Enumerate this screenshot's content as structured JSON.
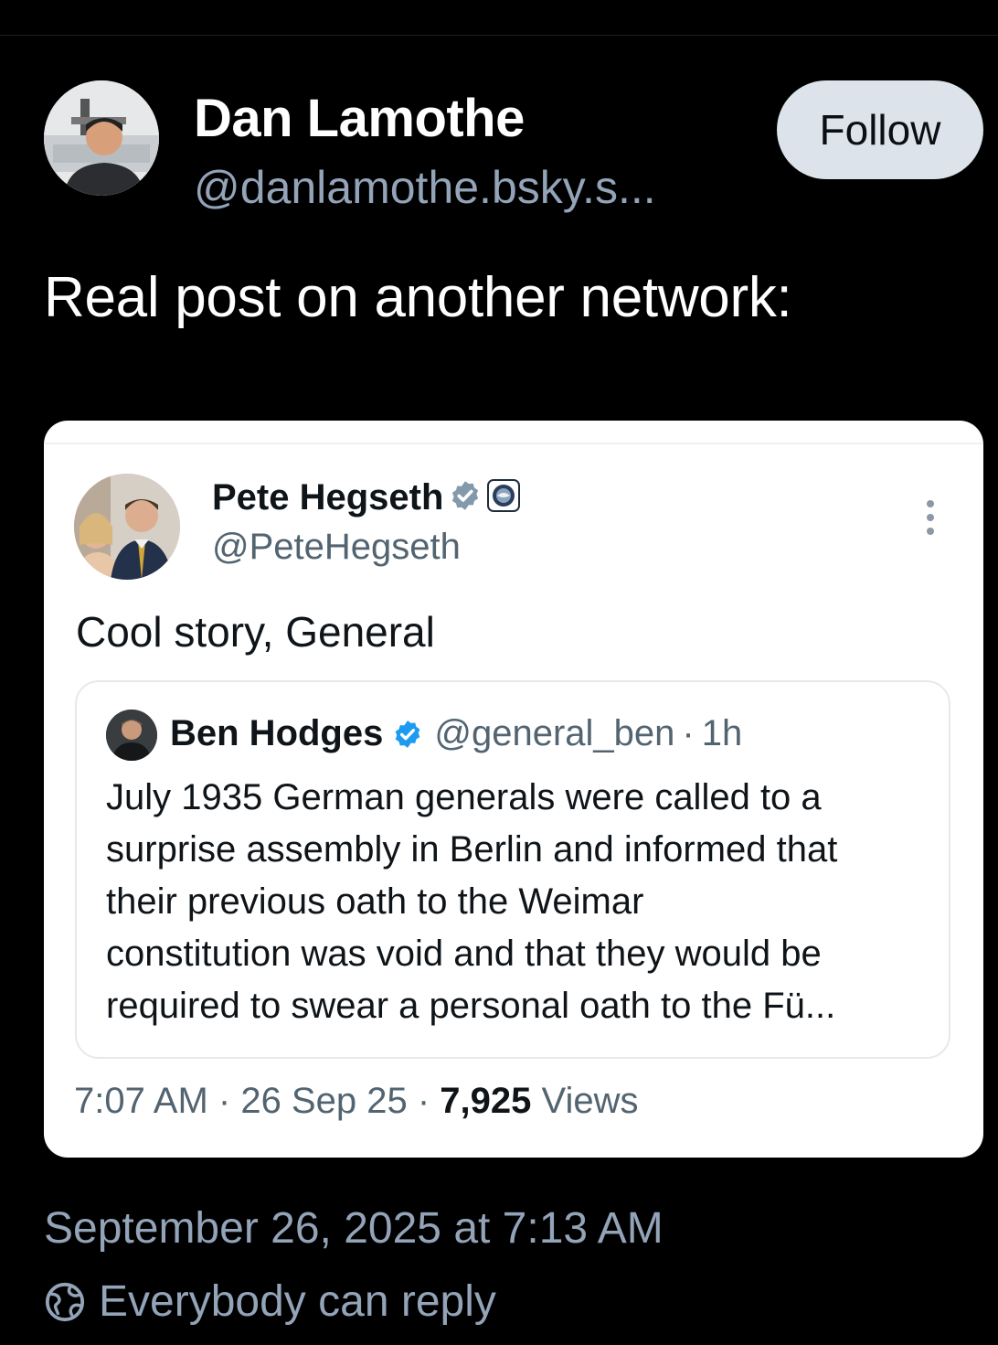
{
  "post": {
    "author_name": "Dan Lamothe",
    "author_handle": "@danlamothe.bsky.s...",
    "follow_label": "Follow",
    "text": "Real post on another network:",
    "timestamp": "September 26, 2025 at 7:13 AM",
    "reply_setting": "Everybody can reply"
  },
  "embed": {
    "name": "Pete Hegseth",
    "handle": "@PeteHegseth",
    "text": "Cool story, General",
    "quote": {
      "name": "Ben Hodges",
      "handle": "@general_ben",
      "age": "1h",
      "lines": [
        "July 1935 German generals were called to a",
        "surprise assembly in Berlin and informed that",
        "their previous oath to the Weimar",
        "constitution was void and that they would be",
        "required to swear a personal oath to the Fü..."
      ]
    },
    "time": "7:07 AM",
    "date": "26 Sep 25",
    "views_count": "7,925",
    "views_label": "Views"
  },
  "icons": {
    "verified": "verified-badge-icon",
    "affiliation": "dod-seal-icon",
    "more": "more-vertical-icon",
    "reply_setting": "earth-icon"
  },
  "colors": {
    "background": "#000000",
    "secondary_text": "#93a3b8",
    "follow_bg": "#dde3ea",
    "verified_gray": "#829aab",
    "verified_blue": "#1d9bf0"
  }
}
